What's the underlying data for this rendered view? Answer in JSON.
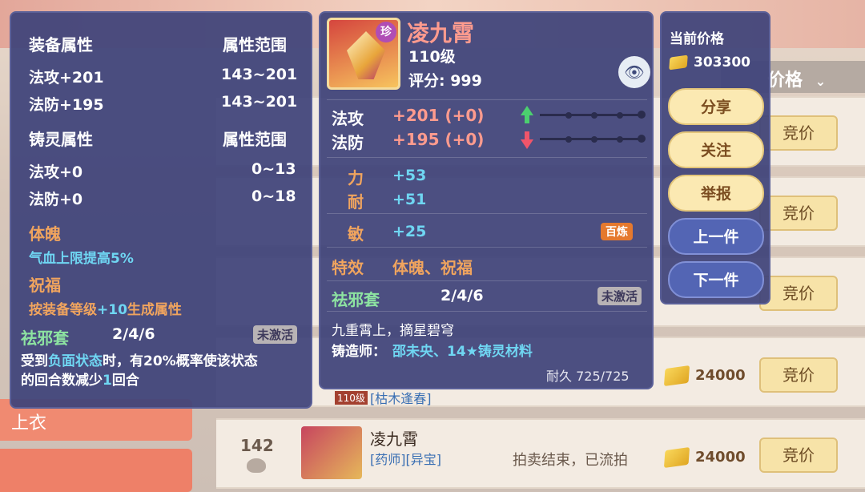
{
  "background": {
    "left_tab_label": "上衣",
    "column_header": "价格",
    "bid_label": "竞价",
    "prices": [
      "24000",
      "24000"
    ],
    "last_row": {
      "number": "142",
      "name": "凌九霄",
      "tags": "[药师][异宝]",
      "status": "拍卖结束，已流拍",
      "level_tag": "110级",
      "prev_tags": "[枯木逢春]"
    }
  },
  "left_panel": {
    "equip_attr_title": "装备属性",
    "attr_range_title": "属性范围",
    "equip_rows": [
      {
        "label": "法攻+201",
        "range": "143~201"
      },
      {
        "label": "法防+195",
        "range": "143~201"
      }
    ],
    "spirit_attr_title": "铸灵属性",
    "spirit_range_title": "属性范围",
    "spirit_rows": [
      {
        "label": "法攻+0",
        "range": "0~13"
      },
      {
        "label": "法防+0",
        "range": "0~18"
      }
    ],
    "effect1_name": "体魄",
    "effect1_desc": "气血上限提高5%",
    "effect2_name": "祝福",
    "effect2_desc_a": "按装备等级",
    "effect2_desc_b": "+10",
    "effect2_desc_c": "生成属性",
    "set_name": "祛邪套",
    "set_progress": "2/4/6",
    "set_status": "未激活",
    "set_desc_a": "受到",
    "set_desc_b": "负面状态",
    "set_desc_c": "时，有20%概率使该状态",
    "set_desc_d": "的回合数减少",
    "set_desc_e": "1",
    "set_desc_f": "回合"
  },
  "main_panel": {
    "item_badge": "珍",
    "item_name": "凌九霄",
    "item_level": "110级",
    "score_label": "评分: 999",
    "stats": [
      {
        "label": "法攻",
        "value": "+201 (+0)"
      },
      {
        "label": "法防",
        "value": "+195 (+0)"
      }
    ],
    "attrs": [
      {
        "label": "力",
        "value": "+53"
      },
      {
        "label": "耐",
        "value": "+51"
      },
      {
        "label": "敏",
        "value": "+25"
      }
    ],
    "refine_badge": "百炼",
    "special_label": "特效",
    "special_value": "体魄、祝福",
    "set_name": "祛邪套",
    "set_progress": "2/4/6",
    "set_status": "未激活",
    "flavor": "九重霄上，摘星碧穹",
    "maker_label": "铸造师：",
    "maker_value": "邵未央、14★铸灵材料",
    "durability": "耐久 725/725"
  },
  "right_panel": {
    "current_price_label": "当前价格",
    "current_price": "303300",
    "buttons": [
      "分享",
      "关注",
      "举报",
      "上一件",
      "下一件"
    ]
  },
  "colors": {
    "panel_bg": "#3e437a",
    "orange": "#f0a45e",
    "cyan": "#6fd6f2",
    "green": "#8de3a1",
    "pink": "#ff9b8e"
  }
}
